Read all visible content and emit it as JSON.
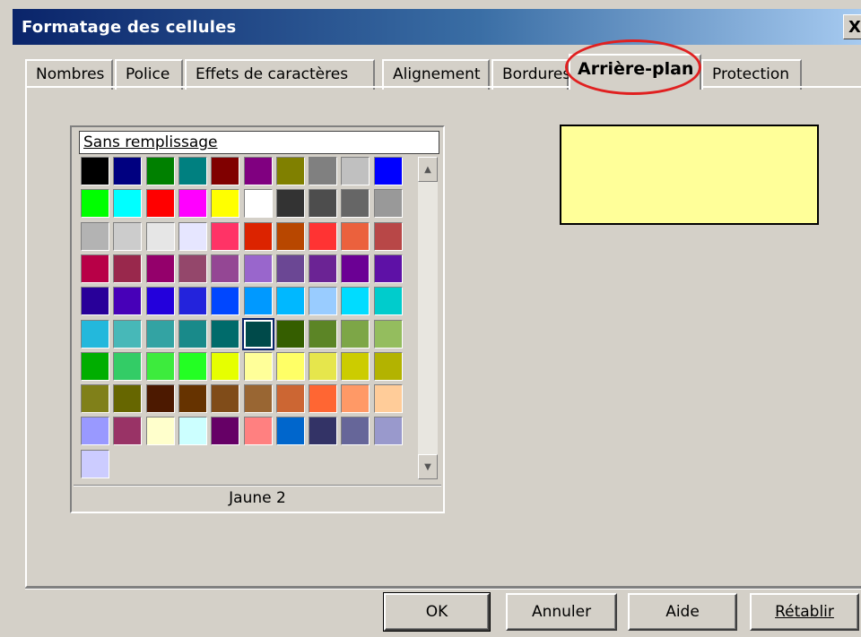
{
  "window": {
    "title": "Formatage des cellules",
    "close_label": "X"
  },
  "tabs": [
    {
      "label": "Nombres",
      "active": false
    },
    {
      "label": "Police",
      "active": false
    },
    {
      "label": "Effets de caractères",
      "active": false
    },
    {
      "label": "Alignement",
      "active": false
    },
    {
      "label": "Bordures",
      "active": false
    },
    {
      "label": "Arrière-plan",
      "active": true
    },
    {
      "label": "Protection",
      "active": false
    }
  ],
  "palette": {
    "no_fill_label": "Sans remplissage",
    "selected_color_name": "Jaune 2",
    "selected_index": 55,
    "colors": [
      "#000000",
      "#000080",
      "#008000",
      "#008080",
      "#800000",
      "#800080",
      "#808000",
      "#808080",
      "#c0c0c0",
      "#0000ff",
      "#00ff00",
      "#00ffff",
      "#ff0000",
      "#ff00ff",
      "#ffff00",
      "#ffffff",
      "#333333",
      "#4d4d4d",
      "#666666",
      "#999999",
      "#b3b3b3",
      "#cccccc",
      "#e6e6e6",
      "#e6e6ff",
      "#ff3366",
      "#dc2300",
      "#b84700",
      "#ff3333",
      "#eb613d",
      "#b84747",
      "#b80047",
      "#99284c",
      "#94006b",
      "#94476b",
      "#944794",
      "#9966cc",
      "#6b4794",
      "#6b2394",
      "#6b0094",
      "#5e11a6",
      "#280099",
      "#4700b8",
      "#2300dc",
      "#2323dc",
      "#0047ff",
      "#0099ff",
      "#00b8ff",
      "#99ccff",
      "#00dcff",
      "#00cccc",
      "#23b8dc",
      "#47b8b8",
      "#33a3a3",
      "#198a8a",
      "#006b6b",
      "#004a4a",
      "#355e00",
      "#5c8526",
      "#7da647",
      "#94bd5e",
      "#00ae00",
      "#33cc66",
      "#3deb3d",
      "#23ff23",
      "#e6ff00",
      "#ffff99",
      "#ffff66",
      "#e6e64c",
      "#cccc00",
      "#b3b300",
      "#808019",
      "#666600",
      "#4c1900",
      "#663300",
      "#804c19",
      "#996633",
      "#cc6633",
      "#ff6633",
      "#ff9966",
      "#ffcc99",
      "#9999ff",
      "#993366",
      "#ffffcc",
      "#ccffff",
      "#660066",
      "#ff8080",
      "#0066cc",
      "#333366",
      "#666699",
      "#9999cc",
      "#ccccff"
    ]
  },
  "preview": {
    "color": "#ffff99"
  },
  "buttons": {
    "ok": "OK",
    "cancel": "Annuler",
    "help": "Aide",
    "reset": "Rétablir"
  }
}
